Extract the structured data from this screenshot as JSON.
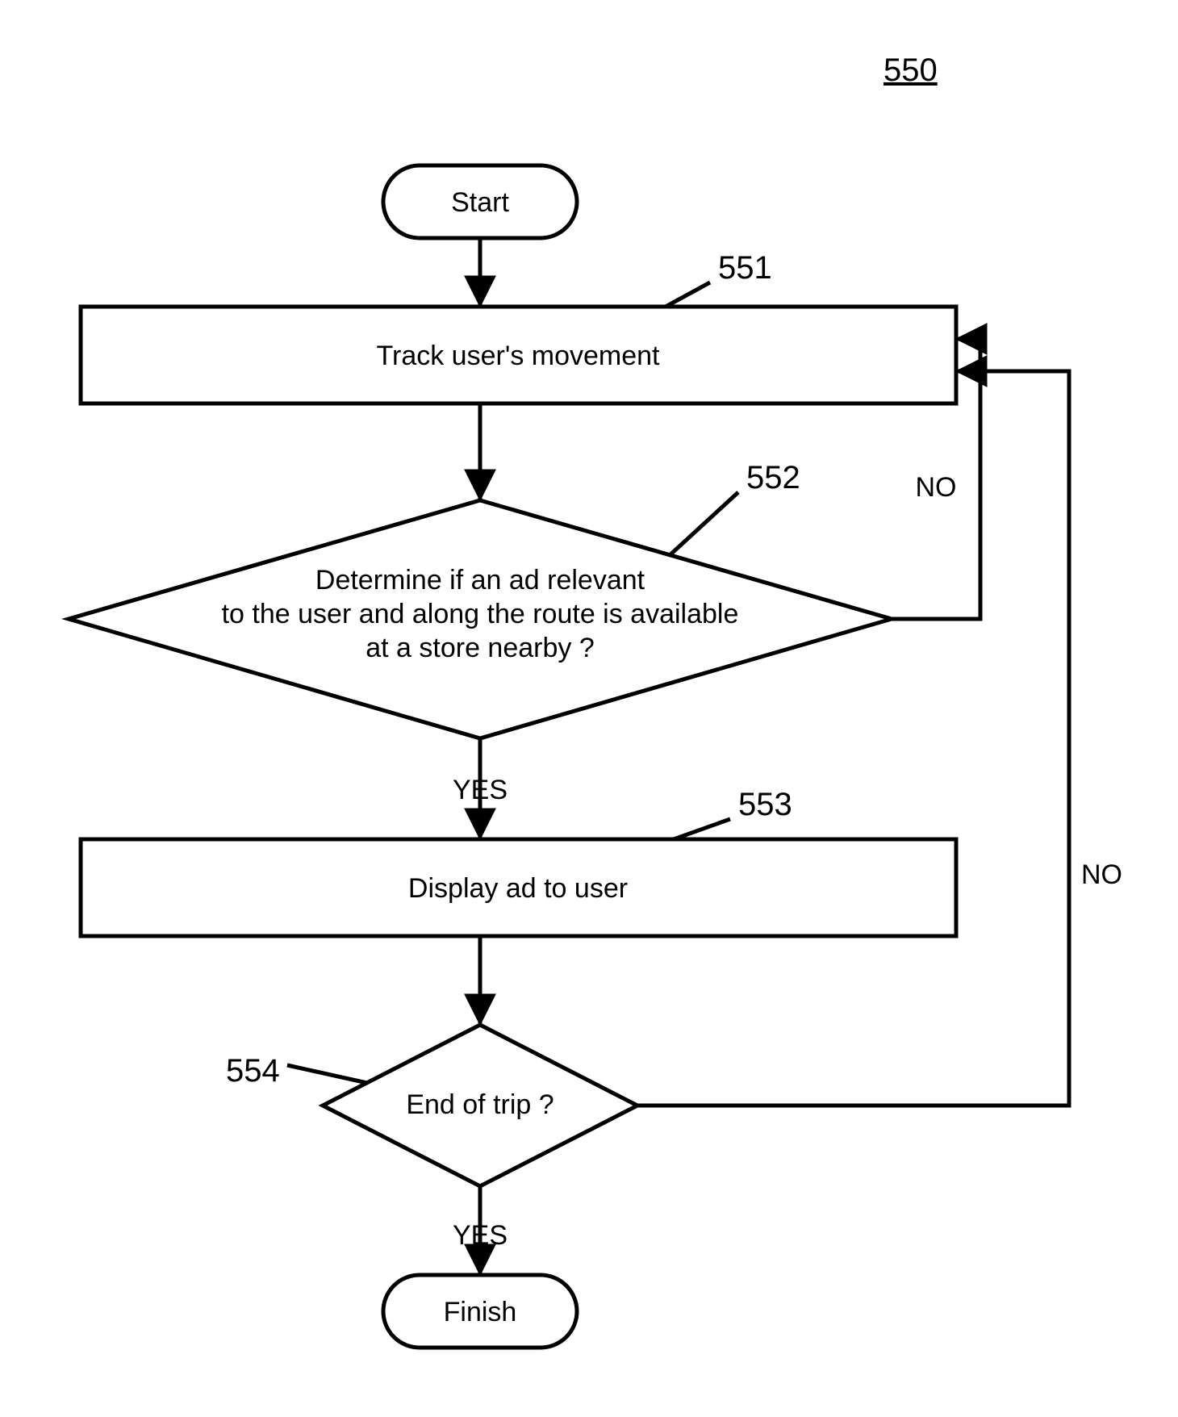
{
  "figure_ref": "550",
  "nodes": {
    "start": {
      "label": "Start"
    },
    "track": {
      "label": "Track user's movement",
      "ref": "551"
    },
    "decide": {
      "line1": "Determine if an ad relevant",
      "line2": "to the user and along the route is available",
      "line3": "at a store nearby ?",
      "ref": "552"
    },
    "display": {
      "label": "Display ad to user",
      "ref": "553"
    },
    "endtrip": {
      "label": "End of trip ?",
      "ref": "554"
    },
    "finish": {
      "label": "Finish"
    }
  },
  "edges": {
    "decide_yes": "YES",
    "decide_no": "NO",
    "endtrip_yes": "YES",
    "endtrip_no": "NO"
  }
}
